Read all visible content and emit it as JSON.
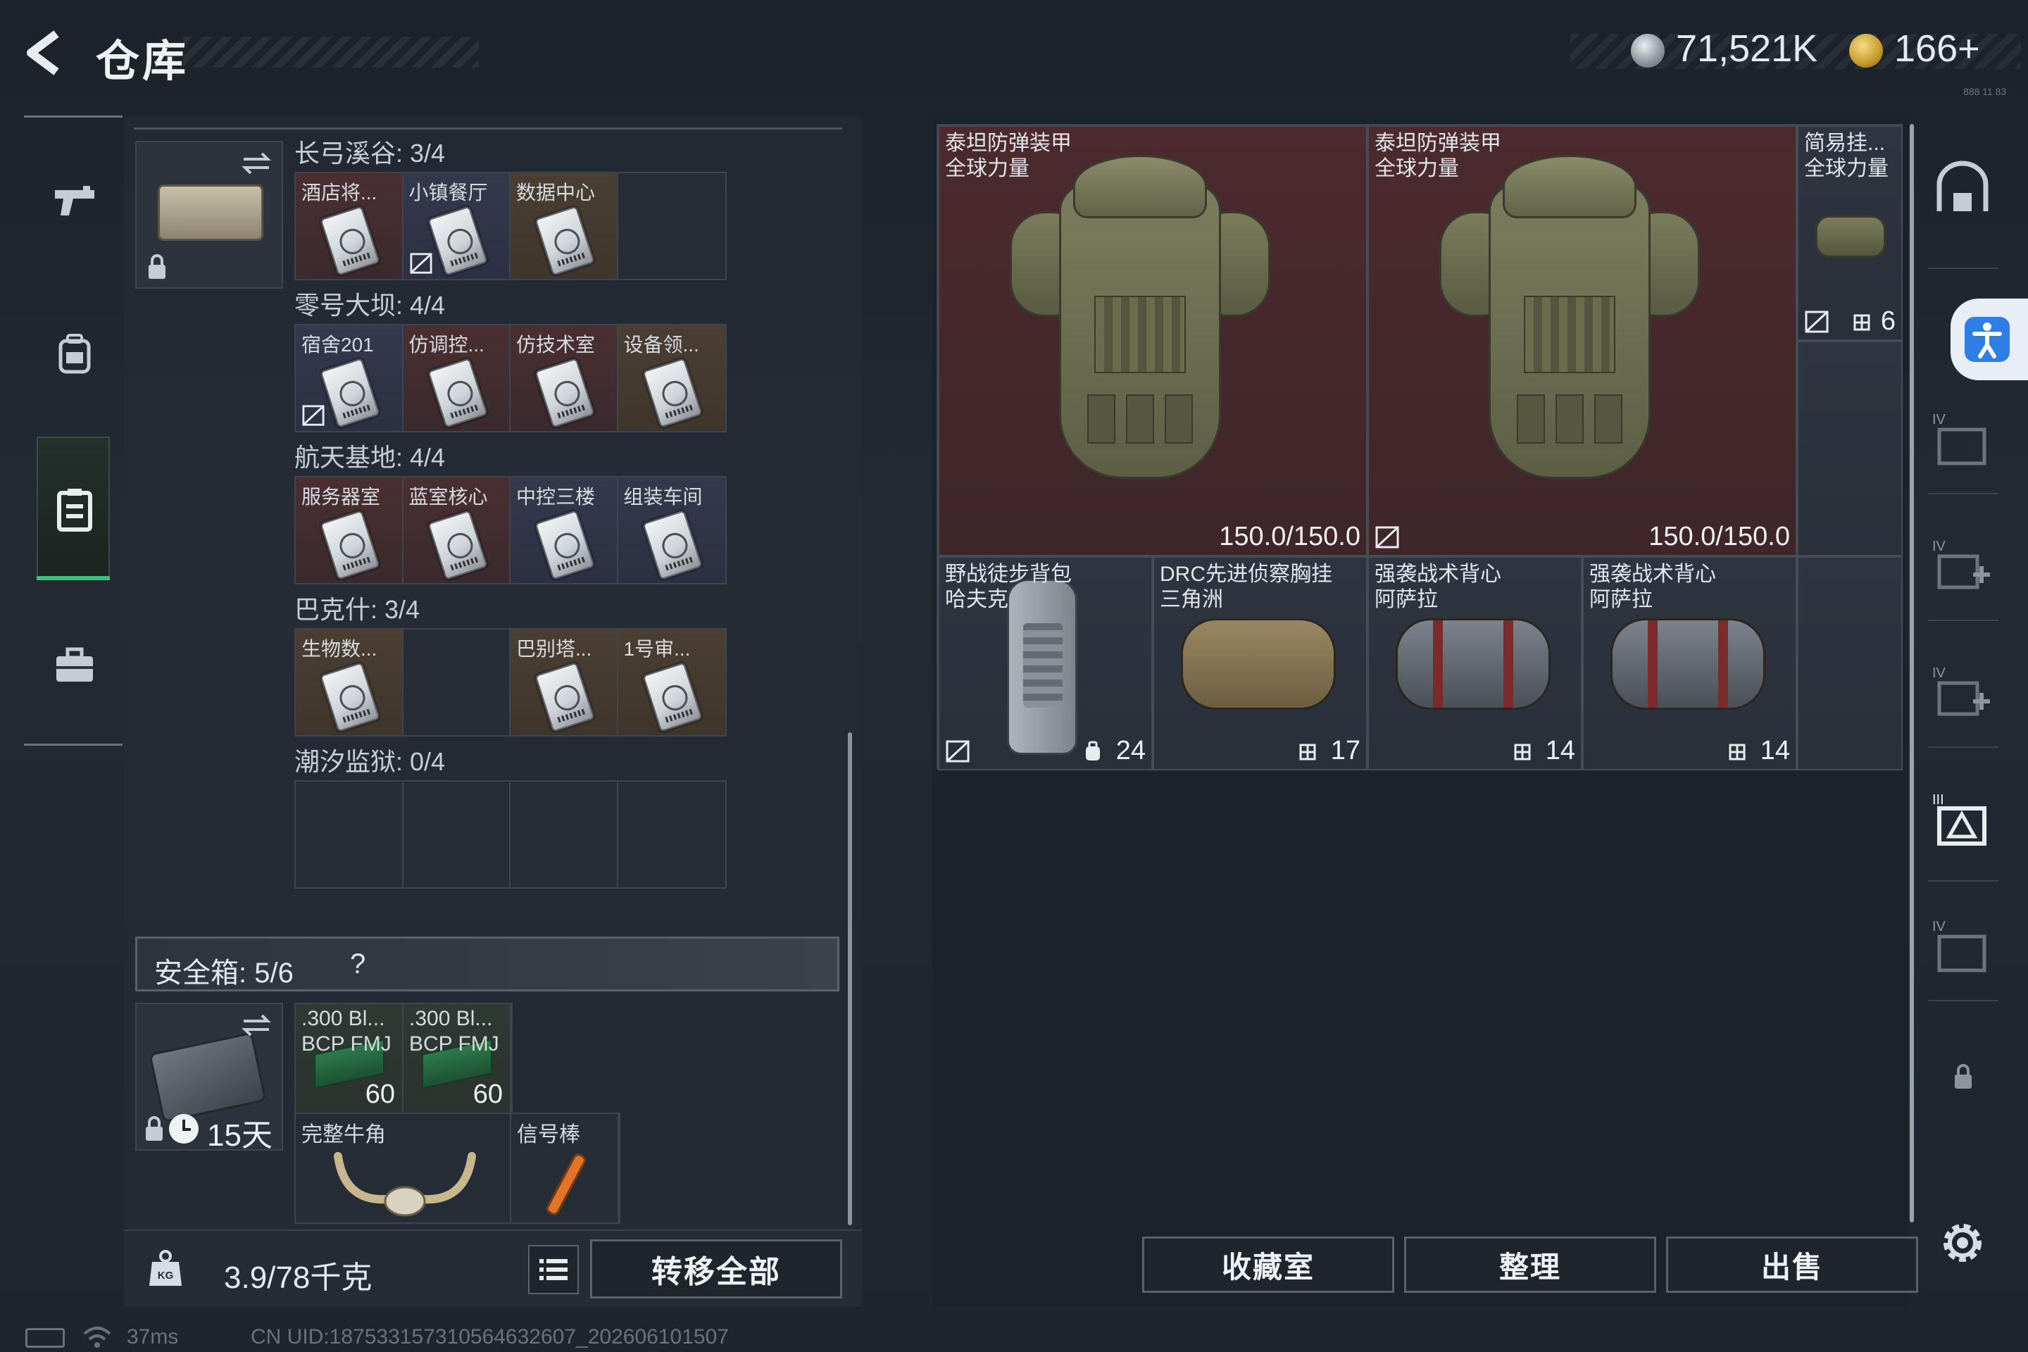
{
  "header": {
    "title": "仓库",
    "silver_amount": "71,521K",
    "gold_amount": "166+",
    "tiny_hint": "888 11 83"
  },
  "left_nav": {
    "items": [
      {
        "name": "weapons",
        "icon": "pistol-icon"
      },
      {
        "name": "gear",
        "icon": "backpack-icon"
      },
      {
        "name": "storage",
        "icon": "locker-icon",
        "selected": true
      },
      {
        "name": "briefcase",
        "icon": "briefcase-icon"
      }
    ]
  },
  "keycards": {
    "sections": [
      {
        "label": "长弓溪谷: 3/4",
        "slots": [
          {
            "label": "酒店将...",
            "color": "red",
            "nosell": false
          },
          {
            "label": "小镇餐厅",
            "color": "blue",
            "nosell": true
          },
          {
            "label": "数据中心",
            "color": "brown",
            "nosell": false
          },
          {
            "label": "",
            "color": "empty",
            "nosell": false
          }
        ]
      },
      {
        "label": "零号大坝: 4/4",
        "slots": [
          {
            "label": "宿舍201",
            "color": "blue",
            "nosell": true
          },
          {
            "label": "仿调控...",
            "color": "red",
            "nosell": false
          },
          {
            "label": "仿技术室",
            "color": "red",
            "nosell": false
          },
          {
            "label": "设备领...",
            "color": "brown",
            "nosell": false
          }
        ]
      },
      {
        "label": "航天基地: 4/4",
        "slots": [
          {
            "label": "服务器室",
            "color": "red",
            "nosell": false
          },
          {
            "label": "蓝室核心",
            "color": "red",
            "nosell": false
          },
          {
            "label": "中控三楼",
            "color": "blue",
            "nosell": false
          },
          {
            "label": "组装车间",
            "color": "blue",
            "nosell": false
          }
        ]
      },
      {
        "label": "巴克什: 3/4",
        "slots": [
          {
            "label": "生物数...",
            "color": "brown",
            "nosell": false
          },
          {
            "label": "",
            "color": "empty",
            "nosell": false
          },
          {
            "label": "巴别塔...",
            "color": "brown",
            "nosell": false
          },
          {
            "label": "1号审...",
            "color": "brown",
            "nosell": false
          }
        ]
      },
      {
        "label": "潮汐监狱: 0/4",
        "slots": [
          {
            "label": "",
            "color": "empty",
            "nosell": false
          },
          {
            "label": "",
            "color": "empty",
            "nosell": false
          },
          {
            "label": "",
            "color": "empty",
            "nosell": false
          },
          {
            "label": "",
            "color": "empty",
            "nosell": false
          }
        ]
      }
    ]
  },
  "safebox": {
    "label": "安全箱: 5/6",
    "help": "?",
    "days": "15天",
    "items": [
      {
        "line1": ".300 Bl...",
        "line2": "BCP FMJ",
        "count": "60"
      },
      {
        "line1": ".300 Bl...",
        "line2": "BCP FMJ",
        "count": "60"
      },
      {
        "line1": "完整牛角",
        "line2": "",
        "count": ""
      },
      {
        "line1": "信号棒",
        "line2": "",
        "count": ""
      }
    ]
  },
  "left_bottom": {
    "weight_icon_text": "KG",
    "weight": "3.9/78千克",
    "transfer_all": "转移全部"
  },
  "items": {
    "armor1": {
      "name": "泰坦防弹装甲",
      "brand": "全球力量",
      "durability": "150.0/150.0"
    },
    "armor2": {
      "name": "泰坦防弹装甲",
      "brand": "全球力量",
      "durability": "150.0/150.0"
    },
    "small_bag": {
      "name": "简易挂...",
      "brand": "全球力量",
      "capacity": "6"
    },
    "backpack": {
      "name": "野战徒步背包",
      "brand": "哈夫克",
      "capacity": "24"
    },
    "chest_rig": {
      "name": "DRC先进侦察胸挂",
      "brand": "三角洲",
      "capacity": "17"
    },
    "vest1": {
      "name": "强袭战术背心",
      "brand": "阿萨拉",
      "capacity": "14"
    },
    "vest2": {
      "name": "强袭战术背心",
      "brand": "阿萨拉",
      "capacity": "14"
    }
  },
  "actions": {
    "collection": "收藏室",
    "organize": "整理",
    "sell": "出售"
  },
  "status": {
    "ping": "37ms",
    "uid": "CN UID:1875331573105646326​07_202606101507"
  },
  "colors": {
    "accent_green": "#3fc07a",
    "armor_bg": "#4c2a2f",
    "accessibility_blue": "#2d7fe6"
  }
}
